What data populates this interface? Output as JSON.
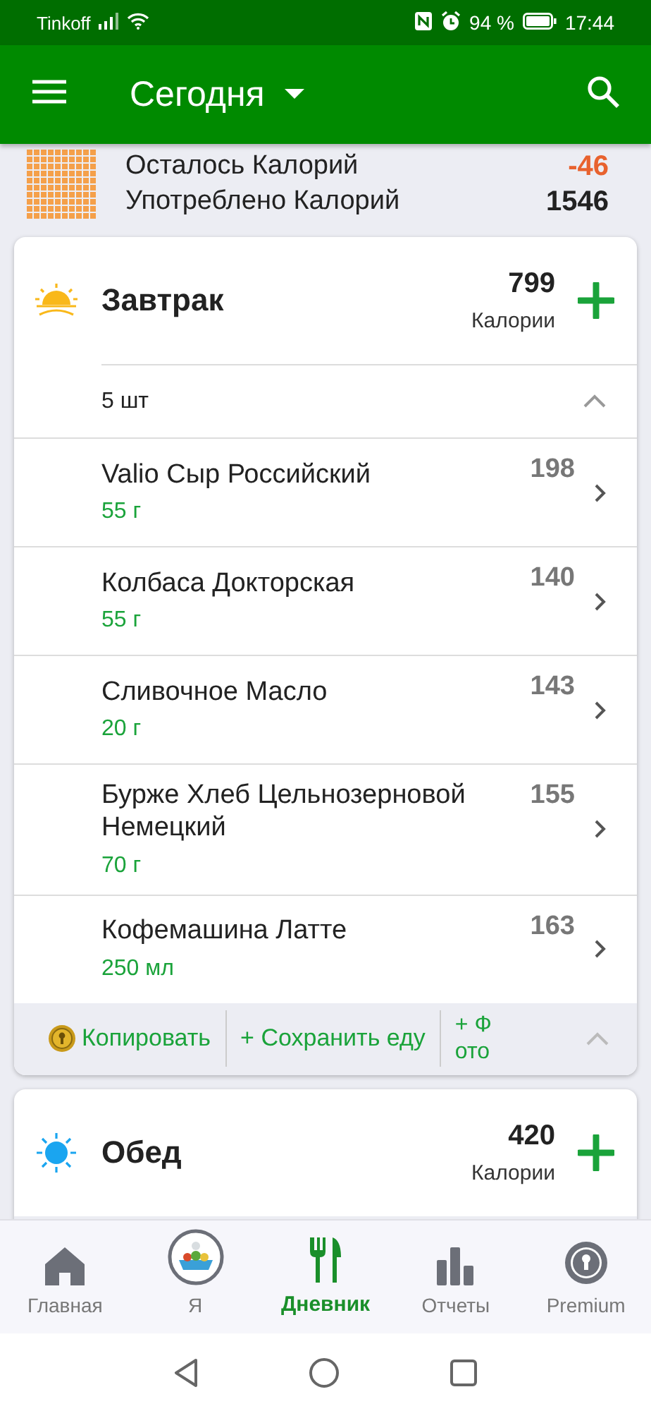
{
  "status_bar": {
    "carrier": "Tinkoff",
    "battery": "94 %",
    "time": "17:44"
  },
  "app_bar": {
    "title": "Сегодня"
  },
  "summary": {
    "remaining_label": "Осталось Калорий",
    "remaining_value": "-46",
    "consumed_label": "Употреблено Калорий",
    "consumed_value": "1546"
  },
  "meals": [
    {
      "kind": "breakfast",
      "name": "Завтрак",
      "calories": "799",
      "calories_label": "Калории",
      "count": "5 шт",
      "expanded": true,
      "items": [
        {
          "name": "Valio Сыр Российский",
          "amount": "55 г",
          "calories": "198"
        },
        {
          "name": "Колбаса Докторская",
          "amount": "55 г",
          "calories": "140"
        },
        {
          "name": "Сливочное Масло",
          "amount": "20 г",
          "calories": "143"
        },
        {
          "name": "Бурже Хлеб Цельнозерновой Немецкий",
          "amount": "70 г",
          "calories": "155"
        },
        {
          "name": "Кофемашина Латте",
          "amount": "250 мл",
          "calories": "163"
        }
      ],
      "actions": [
        {
          "kind": "copy",
          "label": "Копировать"
        },
        {
          "kind": "save",
          "label": "+ Сохранить еду"
        },
        {
          "kind": "photo",
          "label": "+ Фото"
        }
      ]
    },
    {
      "kind": "lunch",
      "name": "Обед",
      "calories": "420",
      "calories_label": "Калории"
    }
  ],
  "bottom_nav": [
    {
      "kind": "home",
      "label": "Главная",
      "selected": false
    },
    {
      "kind": "me",
      "label": "Я",
      "selected": false
    },
    {
      "kind": "diary",
      "label": "Дневник",
      "selected": true
    },
    {
      "kind": "reports",
      "label": "Отчеты",
      "selected": false
    },
    {
      "kind": "premium",
      "label": "Premium",
      "selected": false
    }
  ]
}
